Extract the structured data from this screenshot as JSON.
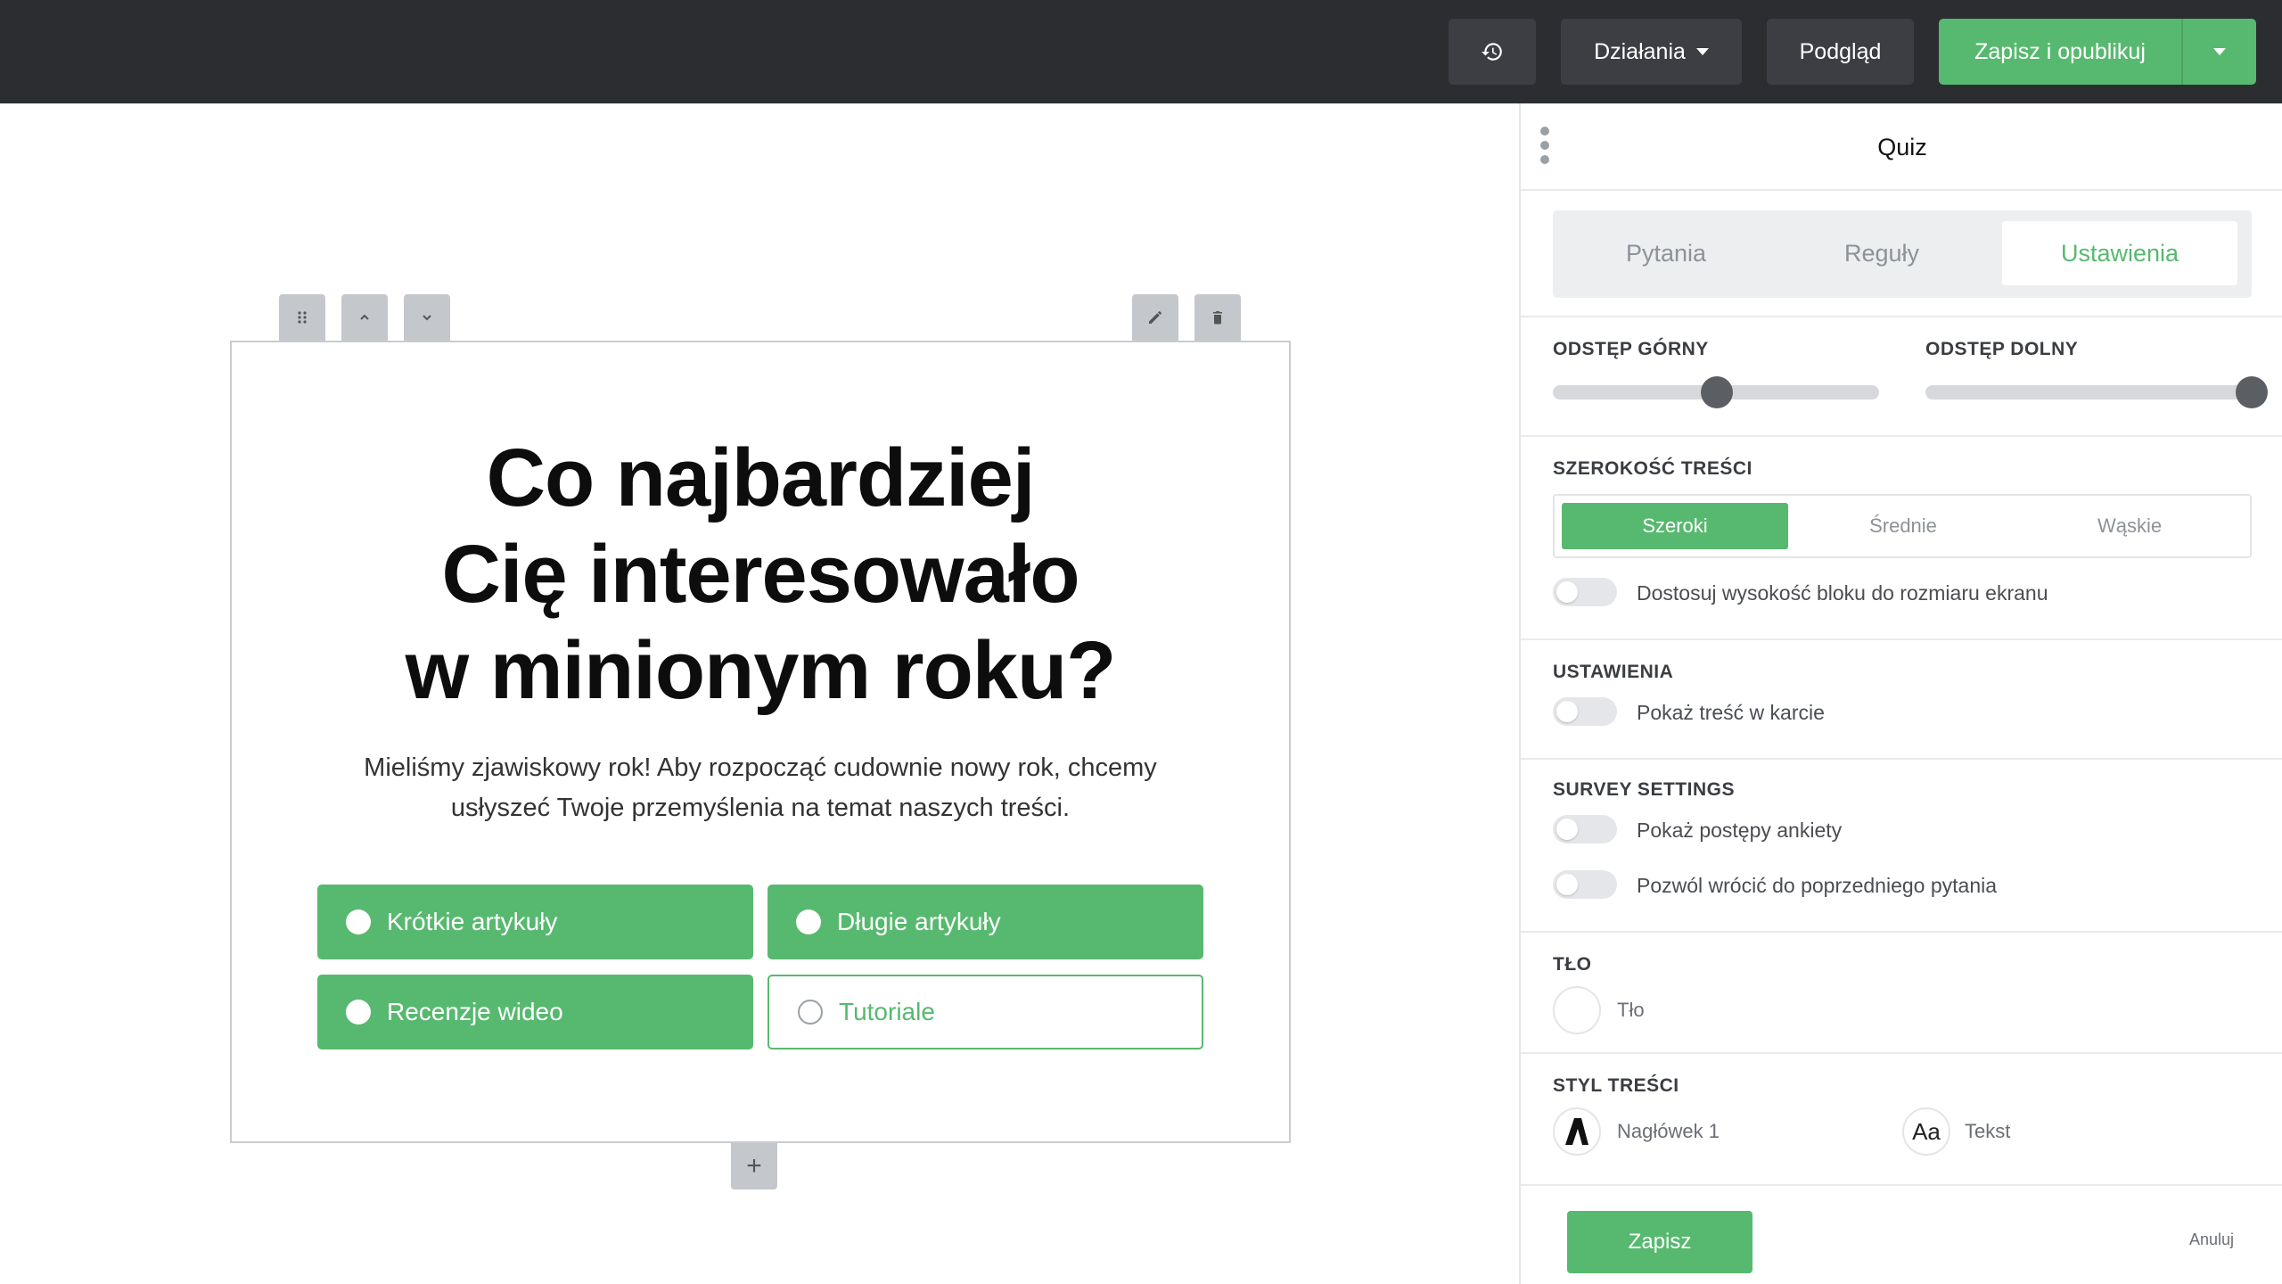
{
  "topbar": {
    "actions_label": "Działania",
    "preview_label": "Podgląd",
    "publish_label": "Zapisz i opublikuj"
  },
  "block": {
    "title_line1": "Co najbardziej",
    "title_line2": "Cię interesowało",
    "title_line3": "w minionym roku?",
    "description_line1": "Mieliśmy zjawiskowy rok! Aby rozpocząć cudownie nowy rok, chcemy",
    "description_line2": "usłyszeć Twoje przemyślenia na temat naszych treści.",
    "options": [
      {
        "label": "Krótkie artykuły",
        "selected": true
      },
      {
        "label": "Długie artykuły",
        "selected": true
      },
      {
        "label": "Recenzje wideo",
        "selected": true
      },
      {
        "label": "Tutoriale",
        "selected": false
      }
    ],
    "add_label": "+"
  },
  "panel": {
    "title": "Quiz",
    "tabs": [
      {
        "label": "Pytania",
        "active": false
      },
      {
        "label": "Reguły",
        "active": false
      },
      {
        "label": "Ustawienia",
        "active": true
      }
    ],
    "spacing": {
      "top_label": "ODSTĘP GÓRNY",
      "top_value_fraction": 0.5,
      "bottom_label": "ODSTĘP DOLNY",
      "bottom_value_fraction": 1.0
    },
    "content_width": {
      "label": "SZEROKOŚĆ TREŚCI",
      "options": [
        "Szeroki",
        "Średnie",
        "Wąskie"
      ],
      "selected": "Szeroki",
      "fit_screen_label": "Dostosuj wysokość bloku do rozmiaru ekranu",
      "fit_screen_on": false
    },
    "settings": {
      "label": "USTAWIENIA",
      "card_label": "Pokaż treść w karcie",
      "card_on": false
    },
    "survey": {
      "label": "SURVEY SETTINGS",
      "progress_label": "Pokaż postępy ankiety",
      "progress_on": false,
      "back_label": "Pozwól wrócić do poprzedniego pytania",
      "back_on": false
    },
    "background": {
      "label": "TŁO",
      "swatch_label": "Tło"
    },
    "content_style": {
      "label": "STYL TREŚCI",
      "heading_label": "Nagłówek 1",
      "text_label": "Tekst",
      "text_icon_glyph": "Aa"
    },
    "footer": {
      "save_label": "Zapisz",
      "cancel_label": "Anuluj"
    }
  },
  "colors": {
    "accent": "#57b96f",
    "topbar_bg": "#2b2d31",
    "topbar_button_bg": "#3c3e44"
  }
}
